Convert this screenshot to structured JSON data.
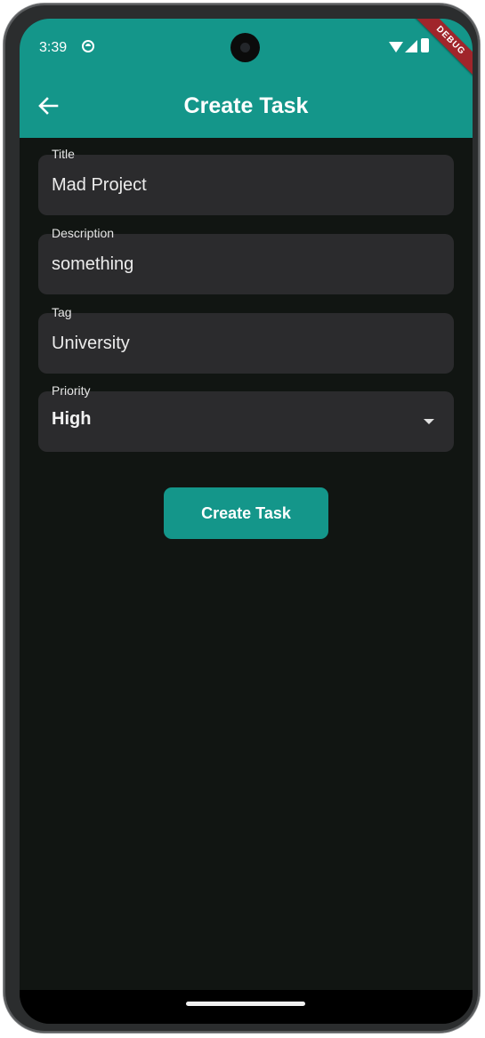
{
  "status_bar": {
    "time": "3:39",
    "icons": [
      "sync-icon",
      "wifi-icon",
      "signal-icon",
      "battery-icon"
    ]
  },
  "debug_banner": "DEBUG",
  "app_bar": {
    "title": "Create Task",
    "back_icon": "arrow-left-icon"
  },
  "form": {
    "title": {
      "label": "Title",
      "value": "Mad Project"
    },
    "description": {
      "label": "Description",
      "value": "something"
    },
    "tag": {
      "label": "Tag",
      "value": "University"
    },
    "priority": {
      "label": "Priority",
      "value": "High",
      "icon": "caret-down-icon"
    }
  },
  "submit_label": "Create Task",
  "colors": {
    "accent": "#14968a",
    "background": "#111512",
    "field_background": "#2b2b2d",
    "debug_banner": "#a0252b"
  }
}
